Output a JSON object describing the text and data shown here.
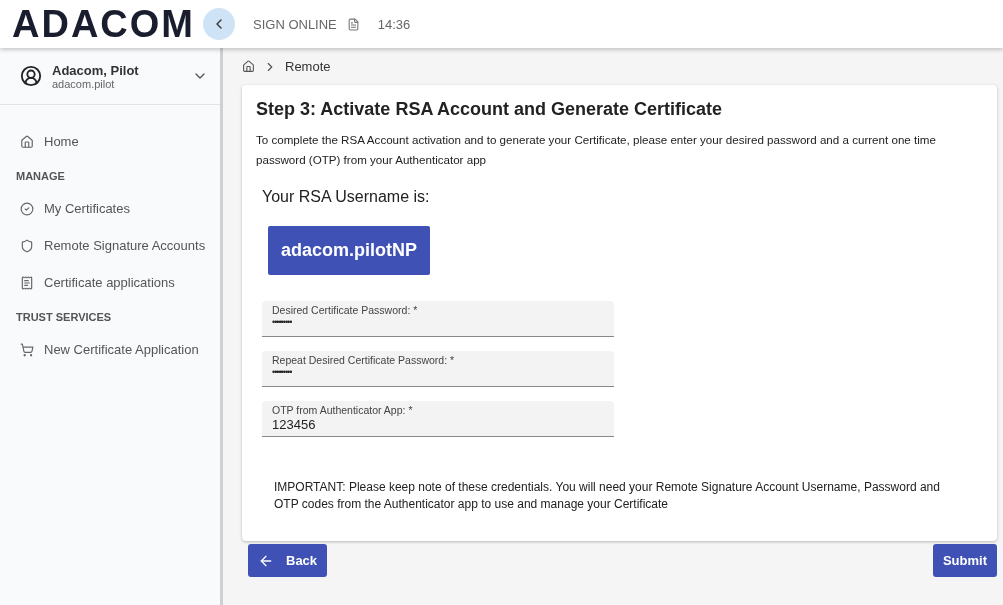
{
  "header": {
    "logo": "ADACOM",
    "app_name": "SIGN ONLINE",
    "time": "14:36"
  },
  "user": {
    "name": "Adacom, Pilot",
    "login": "adacom.pilot"
  },
  "sidebar": {
    "items": [
      {
        "kind": "link",
        "label": "Home"
      },
      {
        "kind": "section",
        "label": "MANAGE"
      },
      {
        "kind": "link",
        "label": "My Certificates"
      },
      {
        "kind": "link",
        "label": "Remote Signature Accounts"
      },
      {
        "kind": "link",
        "label": "Certificate applications"
      },
      {
        "kind": "section",
        "label": "TRUST SERVICES"
      },
      {
        "kind": "link",
        "label": "New Certificate Application"
      }
    ]
  },
  "breadcrumb": {
    "current": "Remote"
  },
  "card": {
    "title": "Step 3: Activate RSA Account and Generate Certificate",
    "intro": "To complete the RSA Account activation and to generate your Certificate, please enter your desired password and a current one time password (OTP) from your Authenticator app",
    "username_label": "Your RSA Username is:",
    "username": "adacom.pilotNP",
    "fields": [
      {
        "kind": "password",
        "label": "Desired Certificate Password: *",
        "value": "•••••••••"
      },
      {
        "kind": "password",
        "label": "Repeat Desired Certificate Password: *",
        "value": "•••••••••"
      },
      {
        "kind": "text",
        "label": "OTP from Authenticator App: *",
        "value": "123456"
      }
    ],
    "note": "IMPORTANT: Please keep note of these credentials. You will need your Remote Signature Account Username, Password and OTP codes from the Authenticator app to use and manage your Certificate"
  },
  "buttons": {
    "back": "Back",
    "submit": "Submit"
  }
}
